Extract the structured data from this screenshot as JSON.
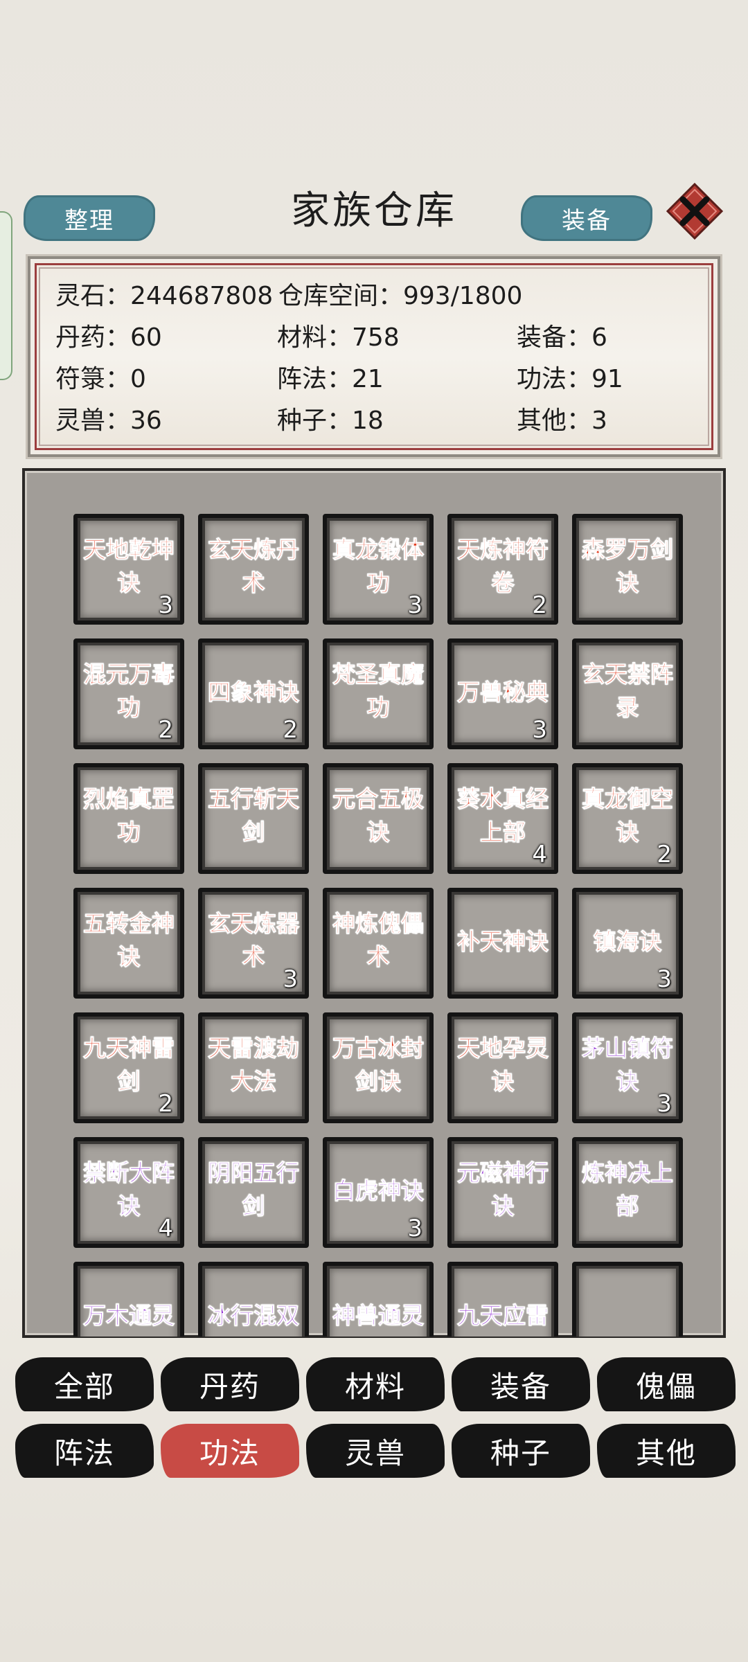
{
  "header": {
    "sort_label": "整理",
    "title": "家族仓库",
    "equip_label": "装备"
  },
  "stats": {
    "spirit_stones": "灵石：244687808",
    "capacity": "仓库空间：993/1800",
    "pills": "丹药：60",
    "materials": "材料：758",
    "equipment": "装备：6",
    "talismans": "符箓：0",
    "formations": "阵法：21",
    "techniques": "功法：91",
    "beasts": "灵兽：36",
    "seeds": "种子：18",
    "others": "其他：3"
  },
  "items": [
    {
      "name": "天地乾坤诀",
      "count": "3",
      "color": "red"
    },
    {
      "name": "玄天炼丹术",
      "count": "",
      "color": "red"
    },
    {
      "name": "真龙锻体功",
      "count": "3",
      "color": "red"
    },
    {
      "name": "天炼神符卷",
      "count": "2",
      "color": "red"
    },
    {
      "name": "森罗万剑诀",
      "count": "",
      "color": "red"
    },
    {
      "name": "混元万毒功",
      "count": "2",
      "color": "red"
    },
    {
      "name": "四象神诀",
      "count": "2",
      "color": "red"
    },
    {
      "name": "梵圣真魔功",
      "count": "",
      "color": "red"
    },
    {
      "name": "万兽秘典",
      "count": "3",
      "color": "red"
    },
    {
      "name": "玄天禁阵录",
      "count": "",
      "color": "red"
    },
    {
      "name": "烈焰真罡功",
      "count": "",
      "color": "red"
    },
    {
      "name": "五行斩天剑",
      "count": "",
      "color": "red"
    },
    {
      "name": "元合五极诀",
      "count": "",
      "color": "red"
    },
    {
      "name": "葵水真经上部",
      "count": "4",
      "color": "red"
    },
    {
      "name": "真龙御空诀",
      "count": "2",
      "color": "red"
    },
    {
      "name": "五转金神诀",
      "count": "",
      "color": "red"
    },
    {
      "name": "玄天炼器术",
      "count": "3",
      "color": "red"
    },
    {
      "name": "神炼傀儡术",
      "count": "",
      "color": "red"
    },
    {
      "name": "补天神诀",
      "count": "",
      "color": "red"
    },
    {
      "name": "镇海诀",
      "count": "3",
      "color": "red"
    },
    {
      "name": "九天神雷剑",
      "count": "2",
      "color": "red"
    },
    {
      "name": "天雷渡劫大法",
      "count": "",
      "color": "red"
    },
    {
      "name": "万古冰封剑诀",
      "count": "",
      "color": "red"
    },
    {
      "name": "天地孕灵诀",
      "count": "",
      "color": "red"
    },
    {
      "name": "茅山镇符诀",
      "count": "3",
      "color": "purple"
    },
    {
      "name": "禁断大阵诀",
      "count": "4",
      "color": "purple"
    },
    {
      "name": "阴阳五行剑",
      "count": "",
      "color": "purple"
    },
    {
      "name": "白虎神诀",
      "count": "3",
      "color": "purple"
    },
    {
      "name": "元磁神行诀",
      "count": "",
      "color": "purple"
    },
    {
      "name": "炼神决上部",
      "count": "",
      "color": "purple"
    },
    {
      "name": "万木通灵",
      "count": "",
      "color": "purple"
    },
    {
      "name": "冰行混双",
      "count": "",
      "color": "purple"
    },
    {
      "name": "神兽通灵",
      "count": "",
      "color": "purple"
    },
    {
      "name": "九天应雷",
      "count": "",
      "color": "purple"
    },
    {
      "name": "",
      "count": "",
      "color": "purple"
    }
  ],
  "categories": [
    {
      "label": "全部",
      "active": false
    },
    {
      "label": "丹药",
      "active": false
    },
    {
      "label": "材料",
      "active": false
    },
    {
      "label": "装备",
      "active": false
    },
    {
      "label": "傀儡",
      "active": false
    },
    {
      "label": "阵法",
      "active": false
    },
    {
      "label": "功法",
      "active": true
    },
    {
      "label": "灵兽",
      "active": false
    },
    {
      "label": "种子",
      "active": false
    },
    {
      "label": "其他",
      "active": false
    }
  ],
  "colors": {
    "red_item": "#e23a1c",
    "purple_item": "#8a1fd0",
    "button_teal": "#4f8896",
    "active_tab": "#c84b45"
  },
  "icons": {
    "close": "close-x-icon"
  }
}
